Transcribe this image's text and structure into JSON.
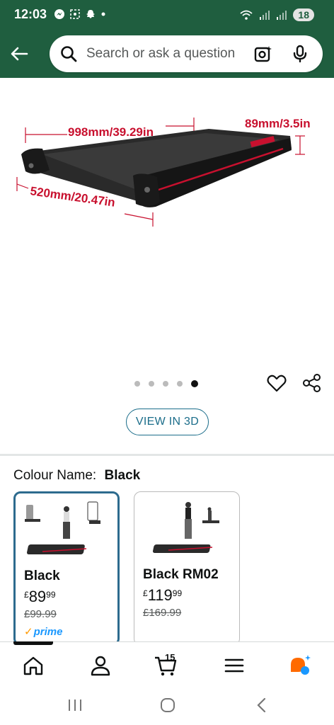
{
  "status_bar": {
    "time": "12:03",
    "battery": "18",
    "left_icons": [
      "messenger-icon",
      "screenshot-icon",
      "snapchat-icon",
      "dot-icon"
    ],
    "right_icons": [
      "wifi-icon",
      "signal-icon",
      "signal-icon"
    ]
  },
  "search": {
    "placeholder": "Search or ask a question"
  },
  "product_image": {
    "length_label": "998mm/39.29in",
    "height_label": "89mm/3.5in",
    "width_label": "520mm/20.47in",
    "image_count": 5,
    "active_index": 4
  },
  "view_3d": {
    "label": "VIEW IN 3D"
  },
  "colour": {
    "label": "Colour Name:",
    "selected": "Black"
  },
  "variants": [
    {
      "name": "Black",
      "price_symbol": "£",
      "price_whole": "89",
      "price_fraction": "99",
      "was_price": "£99.99",
      "prime": "prime",
      "selected": true
    },
    {
      "name": "Black RM02",
      "price_symbol": "£",
      "price_whole": "119",
      "price_fraction": "99",
      "was_price": "£169.99",
      "selected": false
    }
  ],
  "bottom_nav": {
    "cart_count": "15",
    "items": [
      "home-icon",
      "account-icon",
      "cart-icon",
      "menu-icon",
      "rufus-icon"
    ]
  },
  "colors": {
    "header_bg": "#1f5e3f",
    "accent_link": "#1b6d8a",
    "price_strike": "#565959",
    "prime_blue": "#1a98ff",
    "red_accent": "#c8102e"
  }
}
